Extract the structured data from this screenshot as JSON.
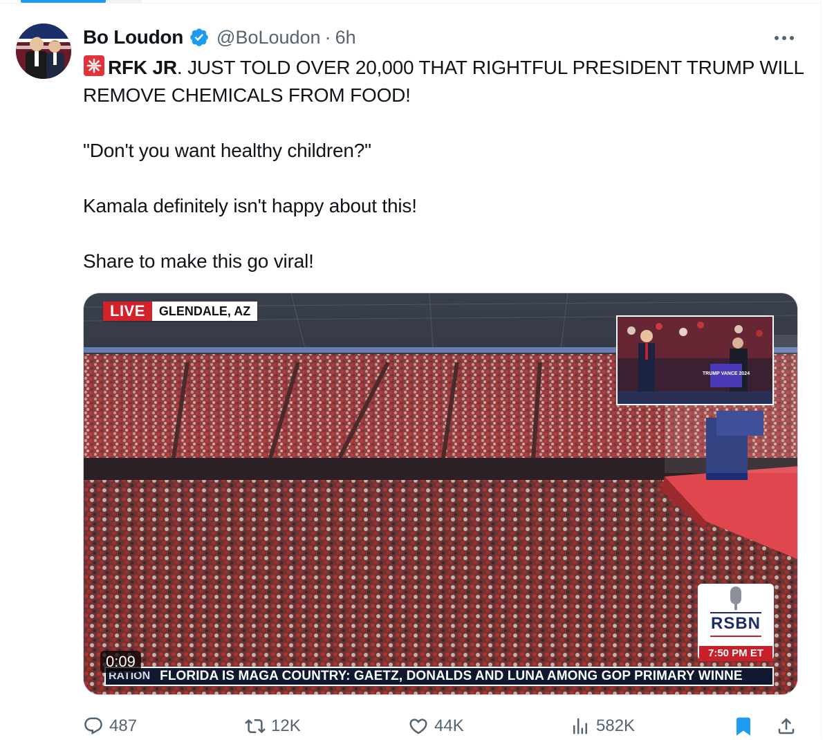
{
  "tweet": {
    "author": {
      "display_name": "Bo Loudon",
      "handle": "@BoLoudon",
      "verified": true
    },
    "separator": "·",
    "time": "6h",
    "text": {
      "line1_bold": "RFK JR",
      "line1_rest": ". JUST TOLD OVER 20,000 THAT RIGHTFUL PRESIDENT TRUMP WILL REMOVE CHEMICALS FROM FOOD!",
      "p2": "\"Don't you want healthy children?\"",
      "p3": "Kamala definitely isn't happy about this!",
      "p4": "Share to make this go viral!"
    },
    "media": {
      "live_label": "LIVE",
      "location": "GLENDALE, AZ",
      "logo": "RSBN",
      "clock": "7:50 PM ET",
      "ticker_tag": "RATION",
      "ticker_text": "FLORIDA IS MAGA COUNTRY: GAETZ, DONALDS AND LUNA AMONG GOP PRIMARY WINNE",
      "duration": "0:09",
      "sign_text": "TRUMP VANCE 2024"
    },
    "actions": {
      "replies": "487",
      "reposts": "12K",
      "likes": "44K",
      "views": "582K"
    }
  },
  "colors": {
    "accent": "#1d9bf0",
    "text_primary": "#0f1419",
    "text_secondary": "#536471",
    "live_red": "#d3232a"
  },
  "icons": [
    "verified-badge-icon",
    "more-icon",
    "siren-emoji-icon",
    "reply-icon",
    "repost-icon",
    "like-icon",
    "views-icon",
    "bookmark-icon",
    "share-icon"
  ]
}
